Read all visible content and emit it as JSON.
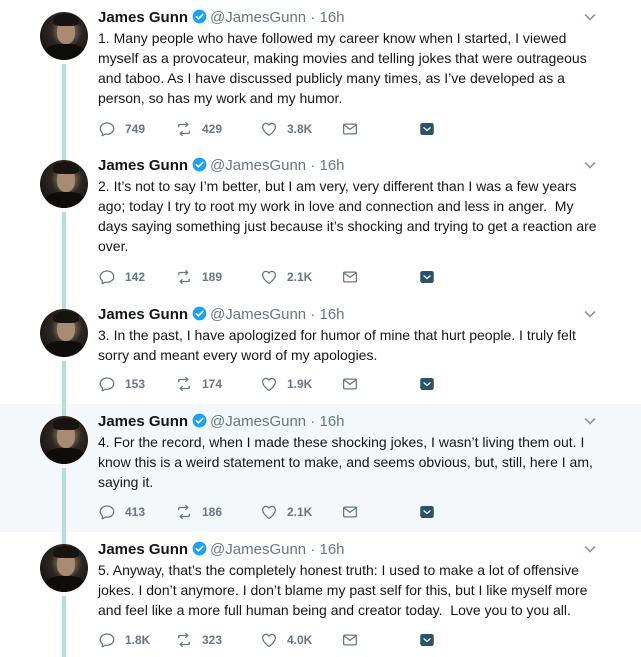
{
  "tweets": [
    {
      "name": "James Gunn",
      "handle": "@JamesGunn",
      "dot": "·",
      "time": "16h",
      "text": "1. Many people who have followed my career know when I started, I viewed myself as a provocateur, making movies and telling jokes that were outrageous and taboo. As I have discussed publicly many times, as I’ve developed as a person, so has my work and my humor.",
      "replies": "749",
      "retweets": "429",
      "likes": "3.8K"
    },
    {
      "name": "James Gunn",
      "handle": "@JamesGunn",
      "dot": "·",
      "time": "16h",
      "text": "2. It’s not to say I’m better, but I am very, very different than I was a few years ago; today I try to root my work in love and connection and less in anger.  My days saying something just because it’s shocking and trying to get a reaction are over.",
      "replies": "142",
      "retweets": "189",
      "likes": "2.1K"
    },
    {
      "name": "James Gunn",
      "handle": "@JamesGunn",
      "dot": "·",
      "time": "16h",
      "text": "3. In the past, I have apologized for humor of mine that hurt people. I truly felt sorry and meant every word of my apologies.",
      "replies": "153",
      "retweets": "174",
      "likes": "1.9K"
    },
    {
      "name": "James Gunn",
      "handle": "@JamesGunn",
      "dot": "·",
      "time": "16h",
      "text": "4. For the record, when I made these shocking jokes, I wasn’t living them out. I know this is a weird statement to make, and seems obvious, but, still, here I am, saying it.",
      "replies": "413",
      "retweets": "186",
      "likes": "2.1K"
    },
    {
      "name": "James Gunn",
      "handle": "@JamesGunn",
      "dot": "·",
      "time": "16h",
      "text": "5. Anyway, that’s the completely honest truth: I used to make a lot of offensive jokes. I don’t anymore. I don’t blame my past self for this, but I like myself more and feel like a more full human being and creator today.  Love you to you all.",
      "replies": "1.8K",
      "retweets": "323",
      "likes": "4.0K"
    }
  ],
  "colors": {
    "verified": "#1da1f2",
    "muted": "#657786",
    "thread_line": "#b8dbe5",
    "highlight_bg": "#f5f8fa",
    "extra_icon": "#2b5266"
  },
  "icons": {
    "verified": "verified-badge-icon",
    "chevron": "chevron-down-icon",
    "reply": "reply-icon",
    "retweet": "retweet-icon",
    "like": "heart-icon",
    "dm": "envelope-icon",
    "extra": "analytics-icon"
  }
}
